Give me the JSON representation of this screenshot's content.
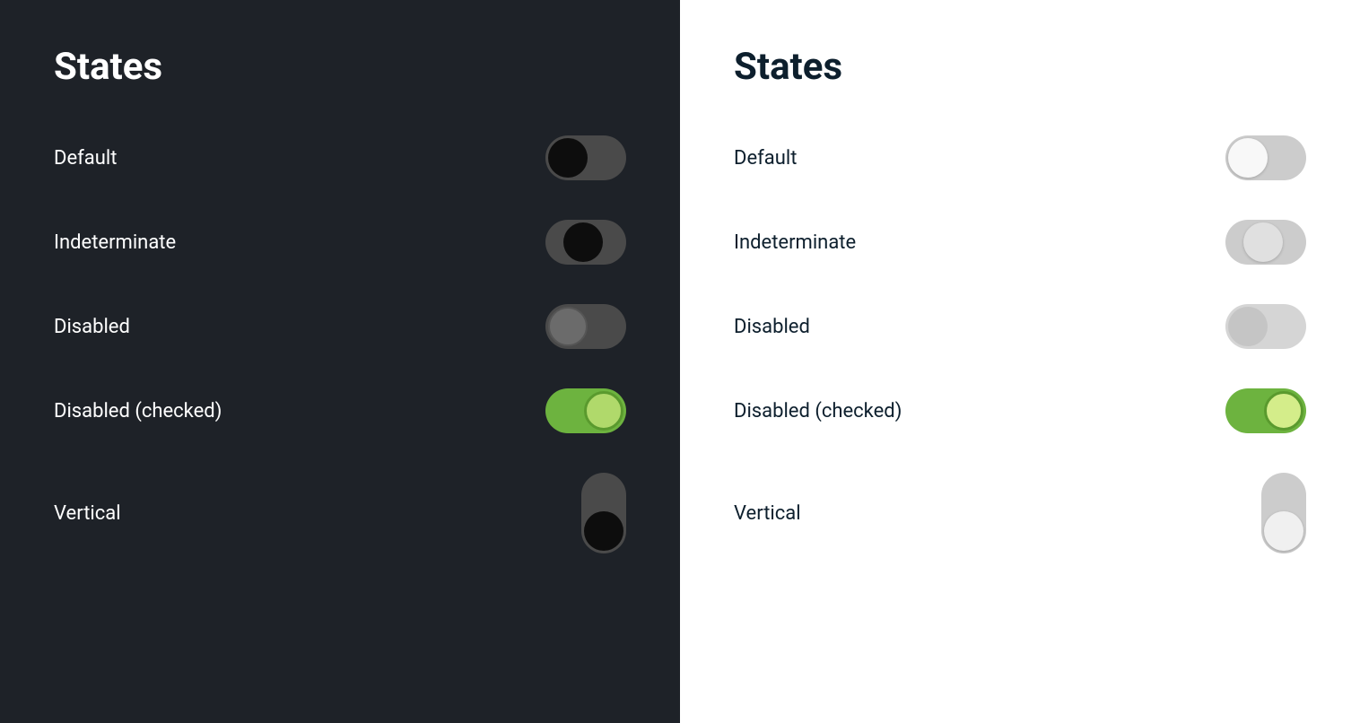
{
  "dark_panel": {
    "title": "States",
    "states": [
      {
        "label": "Default"
      },
      {
        "label": "Indeterminate"
      },
      {
        "label": "Disabled"
      },
      {
        "label": "Disabled (checked)"
      },
      {
        "label": "Vertical"
      }
    ]
  },
  "light_panel": {
    "title": "States",
    "states": [
      {
        "label": "Default"
      },
      {
        "label": "Indeterminate"
      },
      {
        "label": "Disabled"
      },
      {
        "label": "Disabled (checked)"
      },
      {
        "label": "Vertical"
      }
    ]
  }
}
